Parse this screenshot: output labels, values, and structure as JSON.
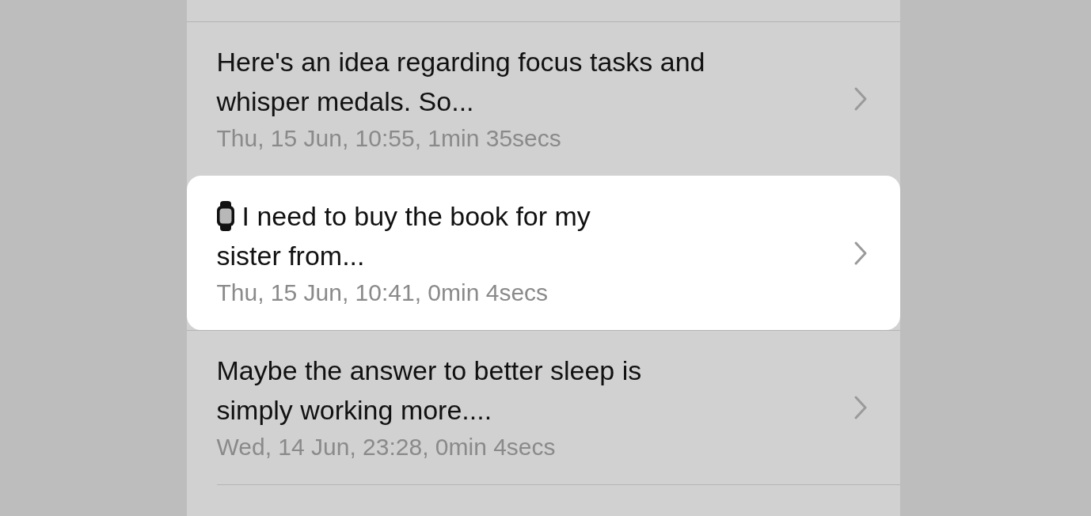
{
  "recordings": [
    {
      "title_lines": [
        "Here's an idea regarding focus tasks and",
        "whisper medals. So..."
      ],
      "details": "Thu, 15 Jun, 10:55, 1min 35secs",
      "selected": false,
      "watch": false
    },
    {
      "title_lines": [
        "I need to buy the book for my",
        "sister from..."
      ],
      "details": "Thu, 15 Jun, 10:41, 0min 4secs",
      "selected": true,
      "watch": true
    },
    {
      "title_lines": [
        "Maybe the answer to better sleep is",
        "simply working more...."
      ],
      "details": "Wed, 14 Jun, 23:28, 0min 4secs",
      "selected": false,
      "watch": false
    }
  ]
}
